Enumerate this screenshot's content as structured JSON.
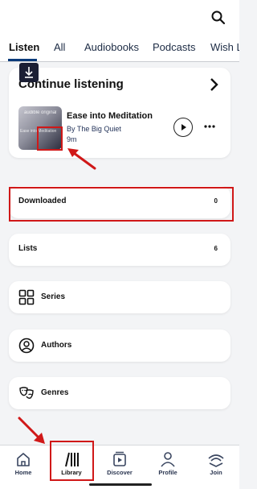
{
  "tabs": [
    {
      "label": "Listen"
    },
    {
      "label": "All"
    },
    {
      "label": "Audiobooks"
    },
    {
      "label": "Podcasts"
    },
    {
      "label": "Wish L"
    }
  ],
  "continue_listening": {
    "title": "Continue listening",
    "book": {
      "title": "Ease into Meditation",
      "author": "By The Big Quiet",
      "duration": "9m",
      "cover_brand": "audible original",
      "cover_text": "Ease into Meditation"
    }
  },
  "library_rows": [
    {
      "label": "Downloaded",
      "count": "0"
    },
    {
      "label": "Lists",
      "count": "6"
    }
  ],
  "collections": [
    {
      "label": "Series",
      "icon": "grid-icon"
    },
    {
      "label": "Authors",
      "icon": "person-circle-icon"
    },
    {
      "label": "Genres",
      "icon": "masks-icon"
    }
  ],
  "bottom_nav": [
    {
      "label": "Home",
      "icon": "home-icon"
    },
    {
      "label": "Library",
      "icon": "library-icon",
      "active": true
    },
    {
      "label": "Discover",
      "icon": "discover-icon"
    },
    {
      "label": "Profile",
      "icon": "profile-icon"
    },
    {
      "label": "Join",
      "icon": "join-icon"
    }
  ],
  "colors": {
    "accent": "#0a3a7a",
    "annotation": "#d01818",
    "background": "#f3f4f6"
  }
}
